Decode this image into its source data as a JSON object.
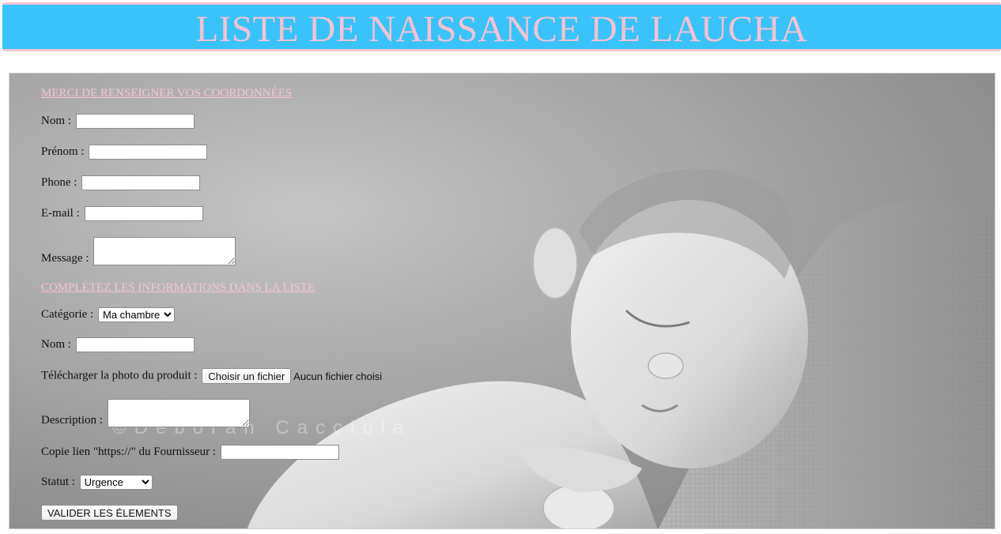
{
  "header": {
    "title": "LISTE DE NAISSANCE DE LAUCHA"
  },
  "photo": {
    "watermark": "©Deborah Cacciola"
  },
  "contact": {
    "section_title": "MERCI DE RENSEIGNER VOS COORDONNÉES",
    "nom_label": "Nom :",
    "nom_value": "",
    "prenom_label": "Prénom :",
    "prenom_value": "",
    "phone_label": "Phone :",
    "phone_value": "",
    "email_label": "E-mail :",
    "email_value": "",
    "message_label": "Message :",
    "message_value": ""
  },
  "item": {
    "section_title": "COMPLÉTEZ LES INFORMATIONS DANS LA LISTE",
    "categorie_label": "Catégorie :",
    "categorie_selected": "Ma chambre",
    "nom_label": "Nom :",
    "nom_value": "",
    "photo_label": "Télécharger la photo du produit :",
    "file_button": "Choisir un fichier",
    "file_status": "Aucun fichier choisi",
    "description_label": "Description :",
    "description_value": "",
    "lien_label": "Copie lien \"https://\" du Fournisseur :",
    "lien_value": "",
    "statut_label": "Statut :",
    "statut_selected": "Urgence"
  },
  "submit": {
    "label": "VALIDER LES ÉLEMENTS"
  },
  "colors": {
    "header_bg": "#3ac2fb",
    "accent_pink": "#f6c3d2"
  }
}
